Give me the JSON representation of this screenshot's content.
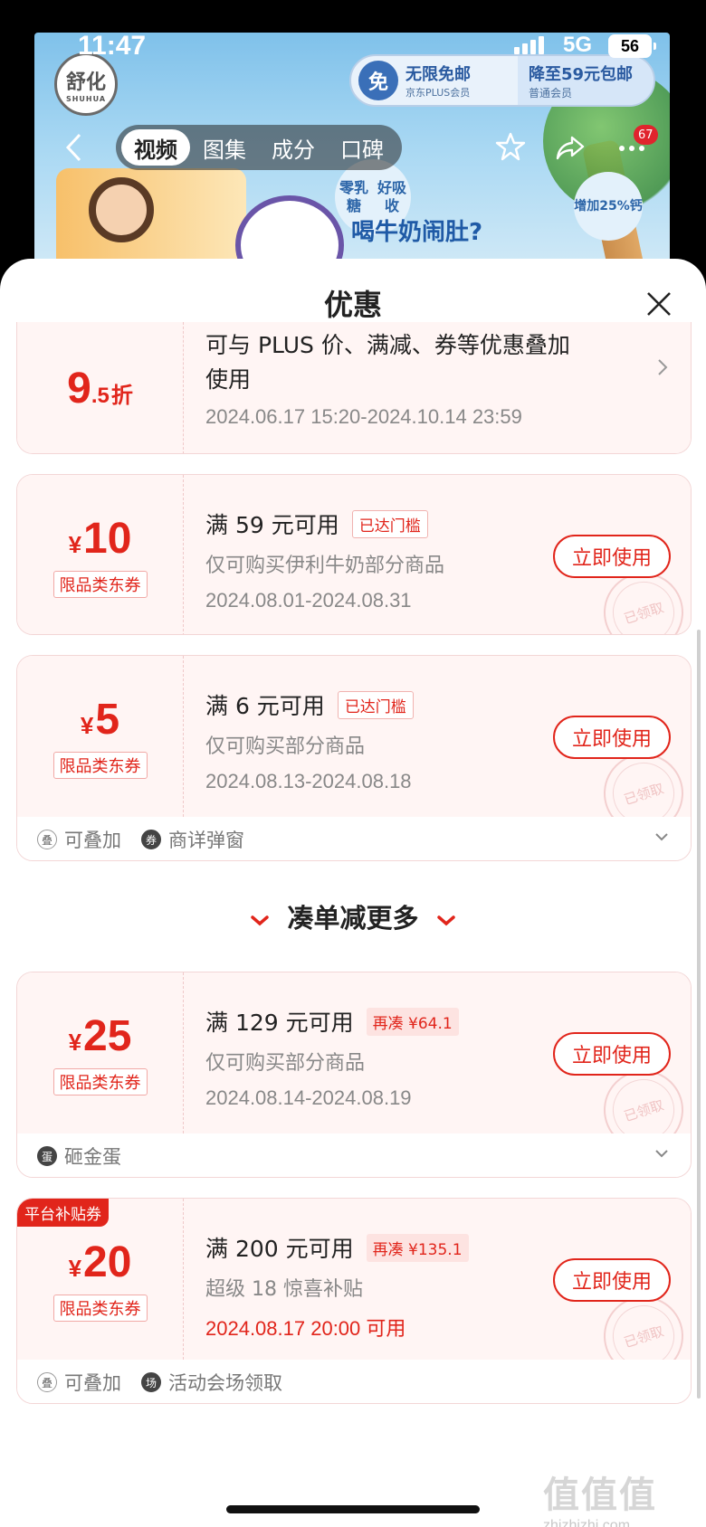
{
  "status": {
    "time": "11:47",
    "network": "5G",
    "battery": "56"
  },
  "hero": {
    "logo_main": "舒化",
    "logo_sub": "SHUHUA",
    "plus_free_icon": "免",
    "plus_title": "无限免邮",
    "plus_sub": "京东PLUS会员",
    "plus_right_title": "降至59元包邮",
    "plus_right_sub": "普通会员",
    "bubble_left": "零乳糖\n好吸收",
    "bubble_right": "增加\n25%钙",
    "promo": "喝牛奶闹肚?"
  },
  "nav": {
    "tabs": [
      {
        "label": "视频"
      },
      {
        "label": "图集"
      },
      {
        "label": "成分"
      },
      {
        "label": "口碑"
      }
    ],
    "more_badge": "67"
  },
  "sheet": {
    "title": "优惠",
    "coupons": [
      {
        "type": "discount",
        "num": "9",
        "dec": ".5",
        "unit": "折",
        "line1": "可与 PLUS 价、满减、券等优惠叠加",
        "line1b": "使用",
        "line3": "2024.06.17 15:20-2024.10.14 23:59"
      },
      {
        "yen": "¥",
        "num": "10",
        "tag": "限品类东券",
        "line1": "满 59 元可用",
        "badge": "已达门槛",
        "line2": "仅可购买伊利牛奶部分商品",
        "line3": "2024.08.01-2024.08.31",
        "btn": "立即使用",
        "stamp": "已领取"
      },
      {
        "yen": "¥",
        "num": "5",
        "tag": "限品类东券",
        "line1": "满 6 元可用",
        "badge": "已达门槛",
        "line2": "仅可购买部分商品",
        "line3": "2024.08.13-2024.08.18",
        "btn": "立即使用",
        "stamp": "已领取",
        "foot": [
          {
            "icon": "叠",
            "text": "可叠加"
          },
          {
            "icon": "券",
            "text": "商详弹窗"
          }
        ]
      }
    ],
    "section_title": "凑单减更多",
    "more_coupons": [
      {
        "yen": "¥",
        "num": "25",
        "tag": "限品类东券",
        "line1": "满 129 元可用",
        "badge": "再凑 ¥64.1",
        "line2": "仅可购买部分商品",
        "line3": "2024.08.14-2024.08.19",
        "btn": "立即使用",
        "stamp": "已领取",
        "foot": [
          {
            "icon": "蛋",
            "text": "砸金蛋"
          }
        ]
      },
      {
        "corner": "平台补贴券",
        "yen": "¥",
        "num": "20",
        "tag": "限品类东券",
        "line1": "满 200 元可用",
        "badge": "再凑 ¥135.1",
        "line2": "超级 18 惊喜补贴",
        "line3": "2024.08.17 20:00 可用",
        "btn": "立即使用",
        "stamp": "已领取",
        "foot": [
          {
            "icon": "叠",
            "text": "可叠加"
          },
          {
            "icon": "场",
            "text": "活动会场领取"
          }
        ]
      }
    ]
  },
  "watermark": {
    "logo": "值值值",
    "site": "zhizhizhi.com"
  }
}
